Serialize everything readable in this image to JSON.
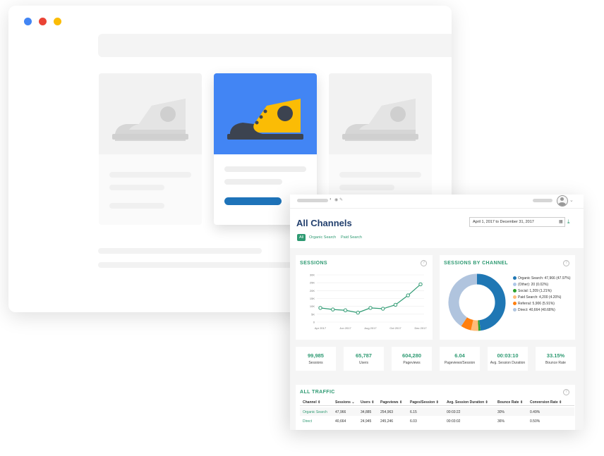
{
  "browser": {
    "dots": [
      {
        "name": "blue",
        "color": "#4285f4"
      },
      {
        "name": "red",
        "color": "#ea4335"
      },
      {
        "name": "yellow",
        "color": "#fbbc05"
      }
    ]
  },
  "colors": {
    "accent_green": "#2e9a72",
    "title_navy": "#23406e",
    "highlight_blue": "#4285f4",
    "shoe_yellow": "#fbbc05",
    "button_blue": "#1e73b9"
  },
  "dashboard": {
    "title": "All Channels",
    "tabs": [
      {
        "label": "All",
        "active": true
      },
      {
        "label": "Organic Search",
        "active": false
      },
      {
        "label": "Paid Search",
        "active": false
      }
    ],
    "date_range": "April 1, 2017 to December 31, 2017",
    "sessions_title": "SESSIONS",
    "by_channel_title": "SESSIONS BY CHANNEL",
    "legend": [
      {
        "label": "Organic Search: 47,966 (47.97%)",
        "color": "#1f77b4"
      },
      {
        "label": "(Other): 20 (0.02%)",
        "color": "#aec7e8"
      },
      {
        "label": "Social: 1,209 (1.21%)",
        "color": "#2ca02c"
      },
      {
        "label": "Paid Search: 4,200 (4.20%)",
        "color": "#ffbb78"
      },
      {
        "label": "Referral: 5,906 (5.91%)",
        "color": "#ff7f0e"
      },
      {
        "label": "Direct: 40,664 (40.68%)",
        "color": "#b0c4de"
      }
    ],
    "metrics": [
      {
        "value": "99,985",
        "label": "Sessions"
      },
      {
        "value": "65,787",
        "label": "Users"
      },
      {
        "value": "604,280",
        "label": "Pageviews"
      },
      {
        "value": "6.04",
        "label": "Pageviews/Session"
      },
      {
        "value": "00:03:10",
        "label": "Avg. Session Duration"
      },
      {
        "value": "33.15%",
        "label": "Bounce Rate"
      }
    ],
    "traffic_title": "ALL TRAFFIC",
    "table": {
      "columns": [
        "Channel ⇕",
        "Sessions ⌄",
        "Users ⇕",
        "Pageviews ⇕",
        "Pages/Session ⇕",
        "Avg. Session Duration ⇕",
        "Bounce Rate ⇕",
        "Conversion Rate ⇕"
      ],
      "rows": [
        [
          "Organic Search",
          "47,966",
          "34,885",
          "254,963",
          "6.15",
          "00:03:22",
          "30%",
          "0.49%"
        ],
        [
          "Direct",
          "40,664",
          "24,945",
          "245,246",
          "6.03",
          "00:03:02",
          "36%",
          "0.50%"
        ]
      ]
    }
  },
  "chart_data": [
    {
      "type": "line",
      "title": "SESSIONS",
      "x": [
        "Apr 2017",
        "May 2017",
        "Jun 2017",
        "Jul 2017",
        "Aug 2017",
        "Sep 2017",
        "Oct 2017",
        "Nov 2017",
        "Dec 2017"
      ],
      "x_tick_labels": [
        "Apr 2017",
        "Jun 2017",
        "Aug 2017",
        "Oct 2017",
        "Dec 2017"
      ],
      "series": [
        {
          "values": [
            9000,
            8000,
            7500,
            6000,
            9000,
            8500,
            11000,
            17000,
            24000
          ],
          "color": "#2e9a72"
        }
      ],
      "y_ticks": [
        "0",
        "5K",
        "10K",
        "15K",
        "20K",
        "25K",
        "30K"
      ],
      "ylim": [
        0,
        30000
      ],
      "grid": true
    },
    {
      "type": "pie",
      "title": "SESSIONS BY CHANNEL",
      "donut": true,
      "slices": [
        {
          "label": "Organic Search",
          "value": 47966,
          "color": "#1f77b4"
        },
        {
          "label": "(Other)",
          "value": 20,
          "color": "#aec7e8"
        },
        {
          "label": "Social",
          "value": 1209,
          "color": "#2ca02c"
        },
        {
          "label": "Paid Search",
          "value": 4200,
          "color": "#ffbb78"
        },
        {
          "label": "Referral",
          "value": 5906,
          "color": "#ff7f0e"
        },
        {
          "label": "Direct",
          "value": 40664,
          "color": "#b0c4de"
        }
      ],
      "legend_position": "right"
    }
  ]
}
